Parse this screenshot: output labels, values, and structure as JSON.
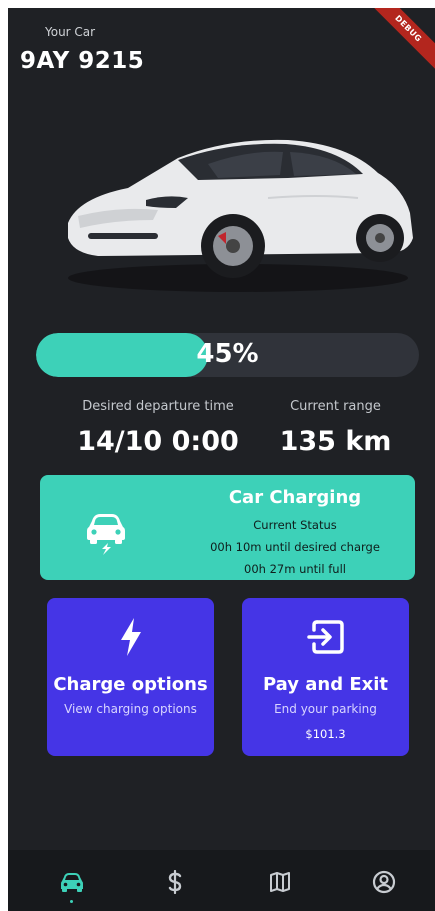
{
  "header": {
    "your_car_label": "Your Car",
    "plate": "9AY 9215",
    "debug_banner": "DEBUG"
  },
  "battery": {
    "percent": 45,
    "percent_label": "45%"
  },
  "stats": {
    "departure_label": "Desired departure time",
    "departure_value": "14/10 0:00",
    "range_label": "Current range",
    "range_value": "135 km"
  },
  "charging_card": {
    "title": "Car Charging",
    "status_label": "Current Status",
    "until_desired": "00h 10m until desired charge",
    "until_full": "00h 27m until full",
    "icon": "car-charging-icon"
  },
  "actions": {
    "charge_options": {
      "title": "Charge options",
      "subtitle": "View charging options",
      "icon": "bolt-icon"
    },
    "pay_exit": {
      "title": "Pay and Exit",
      "subtitle": "End your parking",
      "price": "$101.3",
      "icon": "exit-icon"
    }
  },
  "bottom_nav": {
    "items": [
      "car-icon",
      "dollar-icon",
      "map-icon",
      "account-icon"
    ],
    "active_index": 0
  },
  "colors": {
    "background": "#1f2125",
    "accent_teal": "#3dd1b8",
    "accent_purple": "#4535e6",
    "nav_background": "#17191c",
    "progress_track": "#30333a"
  }
}
